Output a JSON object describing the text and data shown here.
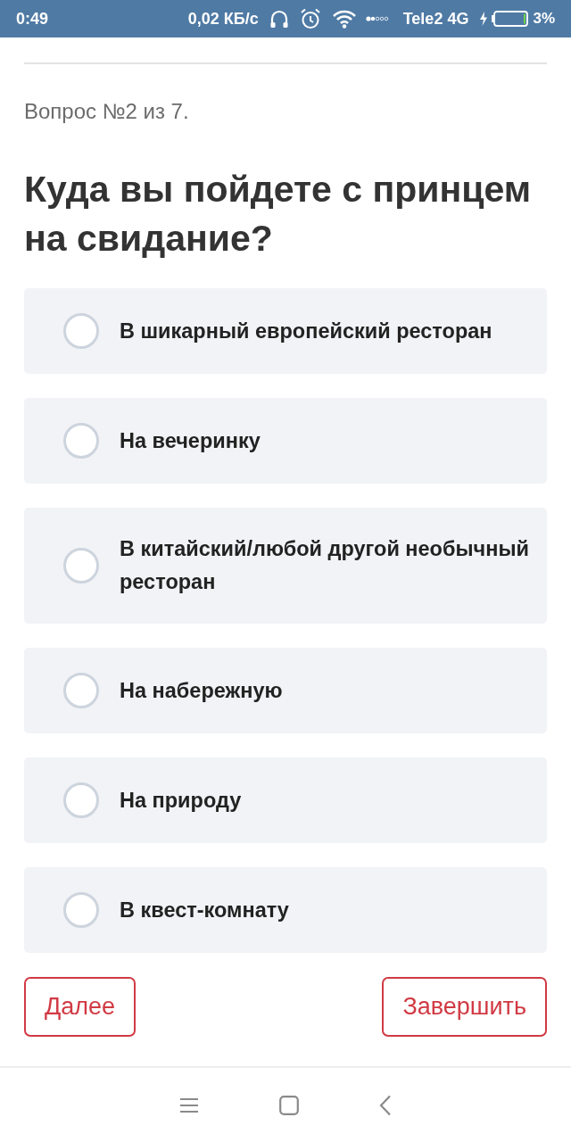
{
  "status_bar": {
    "time": "0:49",
    "speed": "0,02 КБ/с",
    "carrier": "Tele2 4G",
    "battery": "3%"
  },
  "progress": "Вопрос №2 из 7.",
  "question": "Куда вы пойдете с принцем на свидание?",
  "options": [
    {
      "label": "В шикарный европейский ресторан",
      "selected": false
    },
    {
      "label": "На вечеринку",
      "selected": false
    },
    {
      "label": "В китайский/любой другой необычный ресторан",
      "selected": false
    },
    {
      "label": "На набережную",
      "selected": false
    },
    {
      "label": "На природу",
      "selected": false
    },
    {
      "label": "В квест-комнату",
      "selected": false
    }
  ],
  "buttons": [
    {
      "label": "Далее"
    },
    {
      "label": "Завершить"
    }
  ]
}
